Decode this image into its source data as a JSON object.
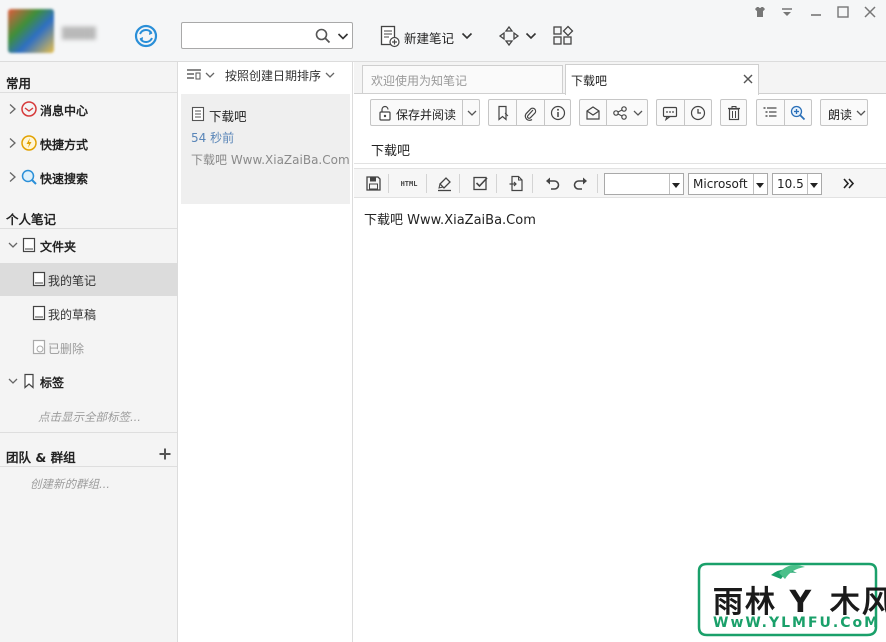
{
  "window": {
    "controls": [
      "shirt-icon",
      "dropdown-icon",
      "minimize-icon",
      "maximize-icon",
      "close-icon"
    ]
  },
  "topbar": {
    "search": {
      "value": "",
      "placeholder": ""
    },
    "new_note_label": "新建笔记"
  },
  "sidebar": {
    "common_heading": "常用",
    "common_items": [
      {
        "label": "消息中心",
        "icon": "message-center-icon"
      },
      {
        "label": "快捷方式",
        "icon": "shortcut-icon"
      },
      {
        "label": "快速搜索",
        "icon": "quick-search-icon"
      }
    ],
    "personal_heading": "个人笔记",
    "folder_label": "文件夹",
    "folder_items": [
      {
        "label": "我的笔记",
        "selected": true
      },
      {
        "label": "我的草稿",
        "selected": false
      },
      {
        "label": "已删除",
        "selected": false
      }
    ],
    "tags_label": "标签",
    "tags_hint": "点击显示全部标签...",
    "team_heading": "团队 & 群组",
    "team_hint": "创建新的群组..."
  },
  "note_list": {
    "sort_label": "按照创建日期排序",
    "notes": [
      {
        "title": "下载吧",
        "time": "54 秒前",
        "snippet": "下载吧 Www.XiaZaiBa.Com"
      }
    ]
  },
  "editor": {
    "tabs": [
      {
        "label": "欢迎使用为知笔记",
        "active": false
      },
      {
        "label": "下载吧",
        "active": true
      }
    ],
    "save_read_label": "保存并阅读",
    "read_label": "朗读",
    "note_title": "下载吧",
    "font_name": "Microsoft",
    "font_size": "10.5",
    "paragraph_style": "",
    "html_label": "HTML",
    "body_text": "下载吧 Www.XiaZaiBa.Com"
  },
  "watermark": {
    "brand_left": "雨林",
    "brand_right": "木风",
    "url": "WwW.YLMFU.CoM"
  },
  "colors": {
    "accent_blue": "#2a8fd8",
    "selected_bg": "#dcdcdc",
    "time_text": "#5a86b8",
    "watermark_green": "#1aa06a"
  }
}
